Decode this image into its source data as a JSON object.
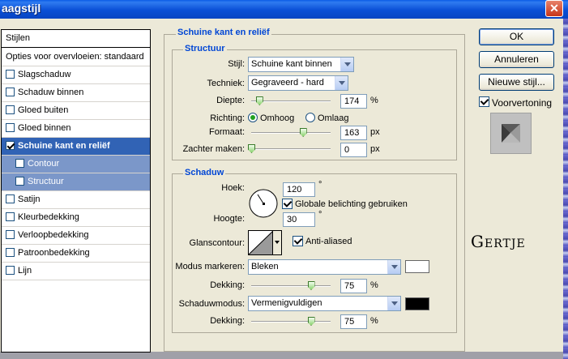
{
  "window": {
    "title": "aagstijl",
    "close_symbol": "✕"
  },
  "sidebar": {
    "header": "Stijlen",
    "items": [
      {
        "label": "Opties voor overvloeien: standaard",
        "checkbox": false
      },
      {
        "label": "Slagschaduw",
        "checkbox": true,
        "checked": false
      },
      {
        "label": "Schaduw binnen",
        "checkbox": true,
        "checked": false
      },
      {
        "label": "Gloed buiten",
        "checkbox": true,
        "checked": false
      },
      {
        "label": "Gloed binnen",
        "checkbox": true,
        "checked": false
      },
      {
        "label": "Schuine kant en reliëf",
        "checkbox": true,
        "checked": true,
        "selected": true
      },
      {
        "label": "Contour",
        "checkbox": true,
        "checked": false,
        "sub": true
      },
      {
        "label": "Structuur",
        "checkbox": true,
        "checked": false,
        "sub": true
      },
      {
        "label": "Satijn",
        "checkbox": true,
        "checked": false
      },
      {
        "label": "Kleurbedekking",
        "checkbox": true,
        "checked": false
      },
      {
        "label": "Verloopbedekking",
        "checkbox": true,
        "checked": false
      },
      {
        "label": "Patroonbedekking",
        "checkbox": true,
        "checked": false
      },
      {
        "label": "Lijn",
        "checkbox": true,
        "checked": false
      }
    ]
  },
  "bevel": {
    "title": "Schuine kant en reliëf",
    "structure": {
      "title": "Structuur",
      "style_label": "Stijl:",
      "style_value": "Schuine kant binnen",
      "technique_label": "Techniek:",
      "technique_value": "Gegraveerd - hard",
      "depth_label": "Diepte:",
      "depth_value": "174",
      "depth_unit": "%",
      "depth_level": 0.1,
      "direction_label": "Richting:",
      "direction_up": "Omhoog",
      "direction_down": "Omlaag",
      "size_label": "Formaat:",
      "size_value": "163",
      "size_unit": "px",
      "size_level": 0.65,
      "soften_label": "Zachter maken:",
      "soften_value": "0",
      "soften_unit": "px",
      "soften_level": 0
    },
    "shading": {
      "title": "Schaduw",
      "angle_label": "Hoek:",
      "angle_value": "120",
      "angle_unit": "°",
      "global_light_label": "Globale belichting gebruiken",
      "altitude_label": "Hoogte:",
      "altitude_value": "30",
      "altitude_unit": "°",
      "gloss_label": "Glanscontour:",
      "anti_aliased_label": "Anti-aliased",
      "highlight_mode_label": "Modus markeren:",
      "highlight_mode_value": "Bleken",
      "highlight_color": "#ffffff",
      "highlight_opacity_label": "Dekking:",
      "highlight_opacity_value": "75",
      "highlight_opacity_unit": "%",
      "highlight_opacity_level": 0.75,
      "shadow_mode_label": "Schaduwmodus:",
      "shadow_mode_value": "Vermenigvuldigen",
      "shadow_color": "#000000",
      "shadow_opacity_label": "Dekking:",
      "shadow_opacity_value": "75",
      "shadow_opacity_unit": "%",
      "shadow_opacity_level": 0.75
    }
  },
  "actions": {
    "ok": "OK",
    "cancel": "Annuleren",
    "new_style": "Nieuwe stijl...",
    "preview_label": "Voorvertoning"
  },
  "logo_text": "Gertje"
}
